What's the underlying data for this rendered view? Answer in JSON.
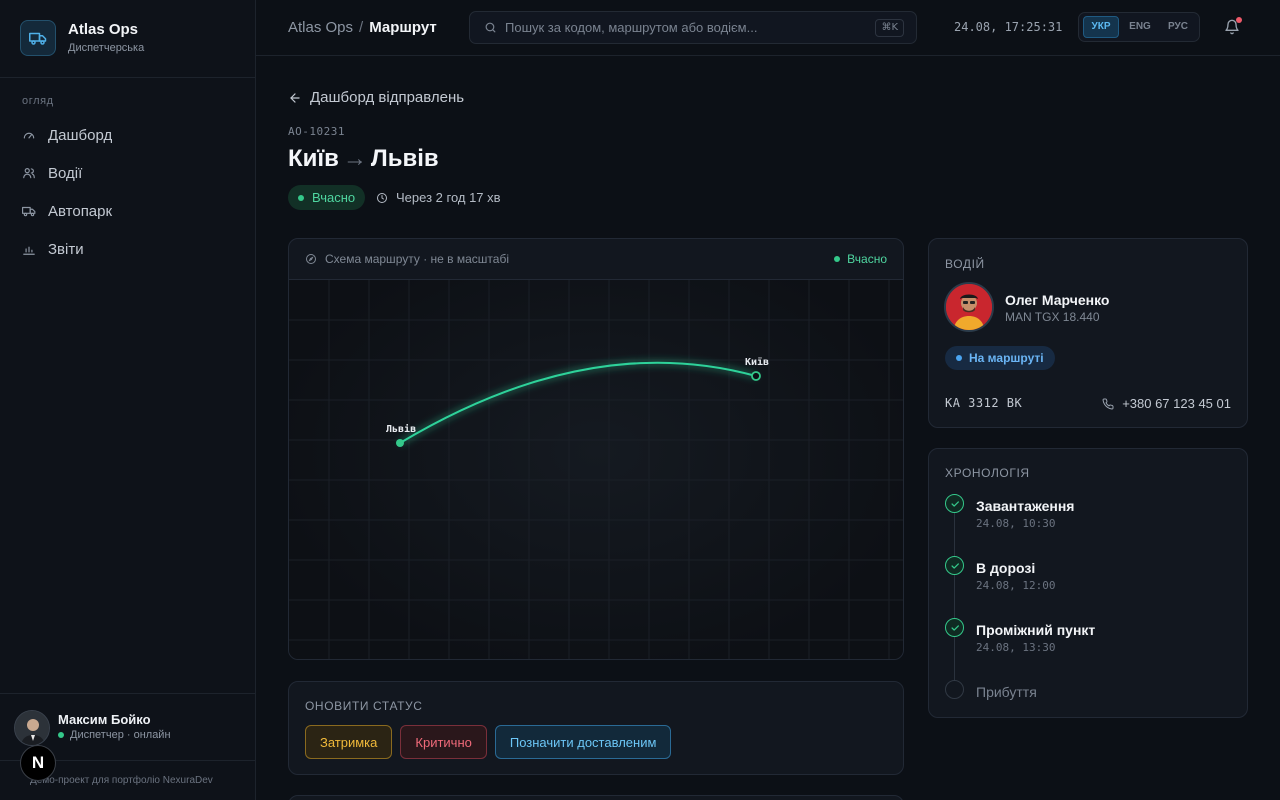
{
  "brand": {
    "name": "Atlas Ops",
    "subtitle": "Диспетчерська",
    "icon": "truck-icon"
  },
  "sidebar": {
    "section": "огляд",
    "items": [
      {
        "label": "Дашборд",
        "icon": "gauge-icon"
      },
      {
        "label": "Водії",
        "icon": "users-icon"
      },
      {
        "label": "Автопарк",
        "icon": "truck-icon"
      },
      {
        "label": "Звіти",
        "icon": "bar-chart-icon"
      }
    ],
    "user": {
      "name": "Максим Бойко",
      "role": "Диспетчер · онлайн"
    },
    "footer": "Демо-проект для портфоліо NexuraDev",
    "badge": "N"
  },
  "topbar": {
    "breadcrumb_root": "Atlas Ops",
    "breadcrumb_sep": "/",
    "breadcrumb_current": "Маршрут",
    "search_placeholder": "Пошук за кодом, маршрутом або водієм...",
    "search_shortcut": "⌘K",
    "datetime": "24.08, 17:25:31",
    "languages": [
      {
        "code": "УКР",
        "active": true
      },
      {
        "code": "ENG",
        "active": false
      },
      {
        "code": "РУС",
        "active": false
      }
    ]
  },
  "page": {
    "back_label": "Дашборд відправлень",
    "shipment_code": "AO-10231",
    "origin": "Київ",
    "arrow": "→",
    "destination": "Львів",
    "status": "Вчасно",
    "eta": "Через 2 год 17 хв"
  },
  "map": {
    "header": "Схема маршруту · не в масштабі",
    "status": "Вчасно",
    "origin_label": "Київ",
    "destination_label": "Львів"
  },
  "status_update": {
    "title": "Оновити статус",
    "buttons": {
      "delay": "Затримка",
      "critical": "Критично",
      "delivered": "Позначити доставленим"
    }
  },
  "driver": {
    "title": "Водій",
    "name": "Олег Марченко",
    "truck": "MAN TGX 18.440",
    "status": "На маршруті",
    "plate": "KA 3312 BK",
    "phone": "+380 67 123 45 01"
  },
  "timeline": {
    "title": "Хронологія",
    "events": [
      {
        "title": "Завантаження",
        "time": "24.08, 10:30",
        "done": true
      },
      {
        "title": "В дорозі",
        "time": "24.08, 12:00",
        "done": true
      },
      {
        "title": "Проміжний пункт",
        "time": "24.08, 13:30",
        "done": true
      },
      {
        "title": "Прибуття",
        "time": "",
        "done": false
      }
    ]
  },
  "colors": {
    "accent": "#34c88a",
    "info": "#4aa4f0",
    "warning": "#f0b93a",
    "danger": "#f06a7a",
    "notification": "#ee5a6a"
  }
}
